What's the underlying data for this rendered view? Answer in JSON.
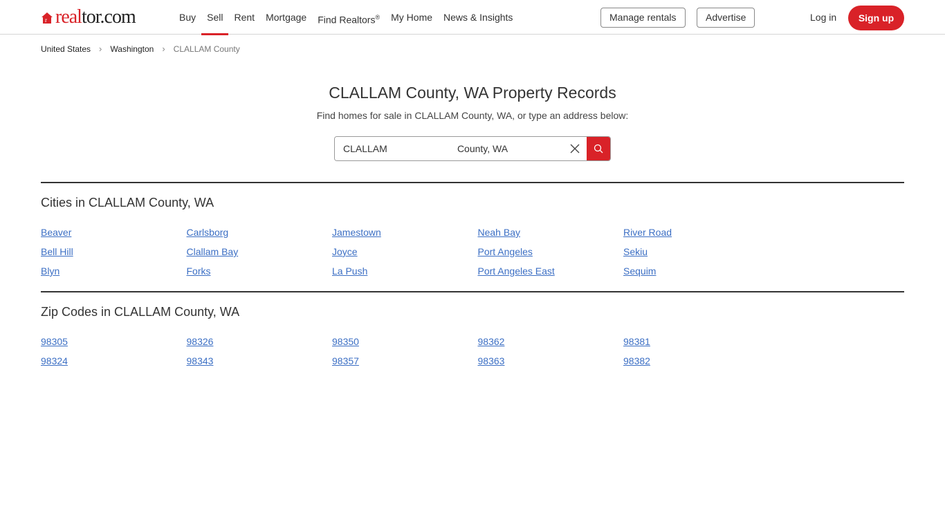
{
  "header": {
    "logo": {
      "red": "real",
      "dark": "tor.com"
    },
    "nav": [
      {
        "label": "Buy"
      },
      {
        "label": "Sell",
        "active": true
      },
      {
        "label": "Rent"
      },
      {
        "label": "Mortgage"
      },
      {
        "label": "Find Realtors",
        "sup": "®"
      },
      {
        "label": "My Home"
      },
      {
        "label": "News & Insights"
      }
    ],
    "manage_rentals": "Manage rentals",
    "advertise": "Advertise",
    "login": "Log in",
    "signup": "Sign up"
  },
  "breadcrumb": [
    "United States",
    "Washington",
    "CLALLAM County"
  ],
  "title": "CLALLAM County, WA Property Records",
  "subtitle": "Find homes for sale in CLALLAM County, WA, or type an address below:",
  "search": {
    "value": "CLALLAM                          County, WA"
  },
  "cities": {
    "heading": "Cities in CLALLAM County, WA",
    "items": [
      "Beaver",
      "Carlsborg",
      "Jamestown",
      "Neah Bay",
      "River Road",
      "Bell Hill",
      "Clallam Bay",
      "Joyce",
      "Port Angeles",
      "Sekiu",
      "Blyn",
      "Forks",
      "La Push",
      "Port Angeles East",
      "Sequim"
    ]
  },
  "zips": {
    "heading": "Zip Codes in CLALLAM County, WA",
    "items": [
      "98305",
      "98326",
      "98350",
      "98362",
      "98381",
      "98324",
      "98343",
      "98357",
      "98363",
      "98382"
    ]
  },
  "colors": {
    "brand": "#d92228",
    "link": "#3c6fc4"
  }
}
